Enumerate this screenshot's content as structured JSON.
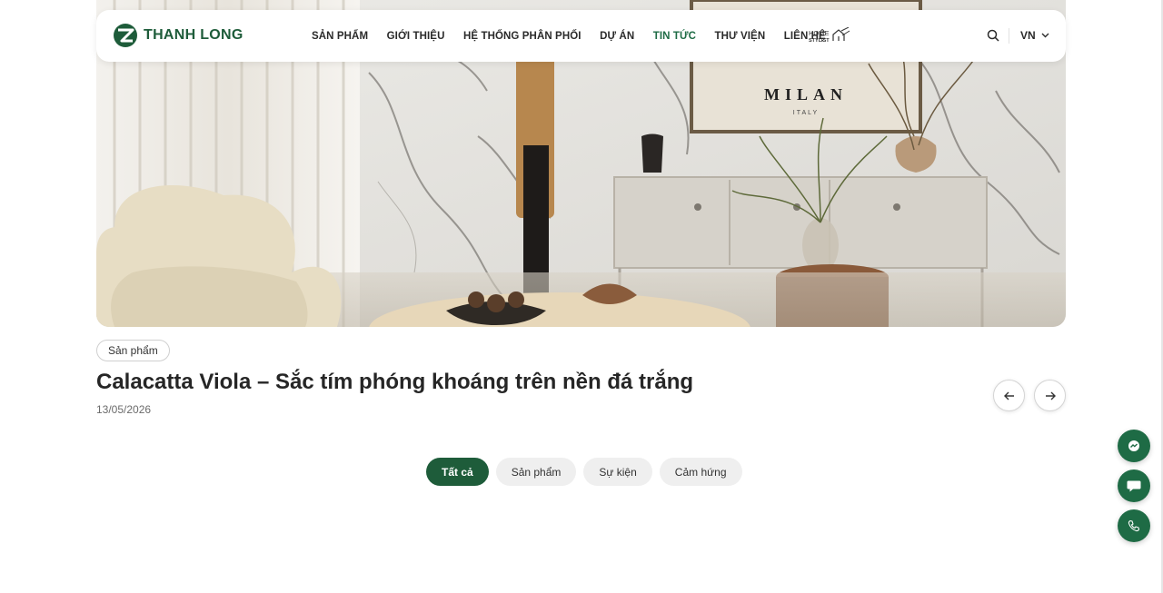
{
  "brand": {
    "name": "THANH LONG"
  },
  "nav": {
    "items": [
      {
        "label": "SẢN PHẨM"
      },
      {
        "label": "GIỚI THIỆU"
      },
      {
        "label": "HỆ THỐNG PHÂN PHỐI"
      },
      {
        "label": "DỰ ÁN"
      },
      {
        "label": "TIN TỨC"
      },
      {
        "label": "THƯ VIỆN"
      },
      {
        "label": "LIÊN HỆ"
      }
    ],
    "active_index": 4,
    "active_color": "#1e6b45",
    "partner_logo": "HOME STYLIST",
    "search_icon": "search-icon",
    "language": "VN"
  },
  "hero": {
    "poster_title": "MILAN",
    "poster_subtitle": "ITALY"
  },
  "article": {
    "category": "Sản phẩm",
    "title": "Calacatta Viola – Sắc tím phóng khoáng trên nền đá trắng",
    "date": "13/05/2026"
  },
  "pager": {
    "prev_icon": "arrow-left-icon",
    "next_icon": "arrow-right-icon"
  },
  "filters": {
    "tabs": [
      {
        "label": "Tất cả"
      },
      {
        "label": "Sản phẩm"
      },
      {
        "label": "Sự kiện"
      },
      {
        "label": "Cảm hứng"
      }
    ],
    "active_index": 0
  },
  "floating": [
    "messenger-icon",
    "chat-icon",
    "phone-icon"
  ],
  "colors": {
    "brand_green": "#1e5c3a",
    "accent_green": "#1e6b45"
  }
}
